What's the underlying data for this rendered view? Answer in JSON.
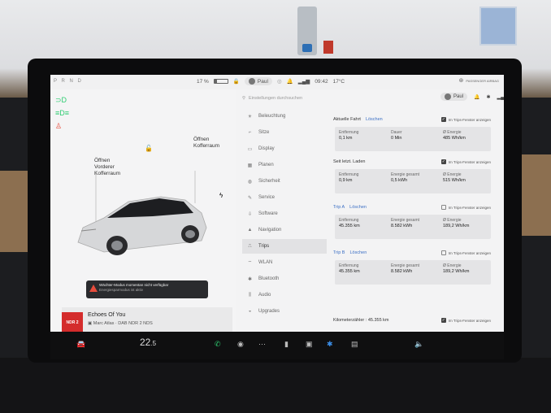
{
  "statusbar": {
    "gears": "P R N D",
    "battery_percent": "17 %",
    "battery_fraction": 0.17,
    "user": "Paul",
    "time": "09:42",
    "outside_temp": "17°C",
    "airbag_text": "PASSENGER AIRBAG"
  },
  "car": {
    "frunk_label": "Öffnen\nVorderer\nKofferraum",
    "trunk_label": "Öffnen\nKofferraum",
    "alert_title": "Wächter-Modus momentan nicht verfügbar",
    "alert_sub": "Energiesparmodus ist aktiv"
  },
  "media": {
    "logo": "NDR 2",
    "title": "Echoes Of You",
    "subtitle": "Marc Atlas · DAB NDR 2 NDS"
  },
  "menu": {
    "search_placeholder": "Einstellungen durchsuchen",
    "items": [
      {
        "label": "Beleuchtung",
        "icon": "lightbulb-icon"
      },
      {
        "label": "Sitze",
        "icon": "seat-icon"
      },
      {
        "label": "Display",
        "icon": "display-icon"
      },
      {
        "label": "Planen",
        "icon": "calendar-icon"
      },
      {
        "label": "Sicherheit",
        "icon": "shield-icon"
      },
      {
        "label": "Service",
        "icon": "wrench-icon"
      },
      {
        "label": "Software",
        "icon": "download-icon"
      },
      {
        "label": "Navigation",
        "icon": "navigation-icon"
      },
      {
        "label": "Trips",
        "icon": "trips-icon"
      },
      {
        "label": "WLAN",
        "icon": "wifi-icon"
      },
      {
        "label": "Bluetooth",
        "icon": "bluetooth-icon"
      },
      {
        "label": "Audio",
        "icon": "audio-icon"
      },
      {
        "label": "Upgrades",
        "icon": "upgrades-icon"
      }
    ],
    "active_index": 8
  },
  "trips": {
    "user": "Paul",
    "checkbox_label": "Im Trips-Fenster anzeigen",
    "sections": [
      {
        "title": "Aktuelle Fahrt",
        "link": "Löschen",
        "checked": true,
        "cells": [
          {
            "label": "Entfernung",
            "value": "0,1 km"
          },
          {
            "label": "Dauer",
            "value": "0 Min"
          },
          {
            "label": "Ø Energie",
            "value": "485 Wh/km"
          }
        ]
      },
      {
        "title": "Seit letzt. Laden",
        "link": "",
        "checked": true,
        "cells": [
          {
            "label": "Entfernung",
            "value": "0,9 km"
          },
          {
            "label": "Energie gesamt",
            "value": "0,5 kWh"
          },
          {
            "label": "Ø Energie",
            "value": "515 Wh/km"
          }
        ]
      },
      {
        "title": "Trip A",
        "link": "Löschen",
        "checked": false,
        "cells": [
          {
            "label": "Entfernung",
            "value": "45.355 km"
          },
          {
            "label": "Energie gesamt",
            "value": "8.582 kWh"
          },
          {
            "label": "Ø Energie",
            "value": "189,2 Wh/km"
          }
        ]
      },
      {
        "title": "Trip B",
        "link": "Löschen",
        "checked": false,
        "cells": [
          {
            "label": "Entfernung",
            "value": "45.355 km"
          },
          {
            "label": "Energie gesamt",
            "value": "8.582 kWh"
          },
          {
            "label": "Ø Energie",
            "value": "189,2 Wh/km"
          }
        ]
      }
    ],
    "odometer_label": "Kilometerzähler",
    "odometer_value": "45.355 km",
    "odometer_checked": true
  },
  "dock": {
    "cabin_temp": "22",
    "cabin_temp_decimal": ".5"
  },
  "colors": {
    "accent_blue": "#3b6fc4",
    "alert_red": "#e74c3c",
    "indicator_green": "#2ecc71"
  }
}
